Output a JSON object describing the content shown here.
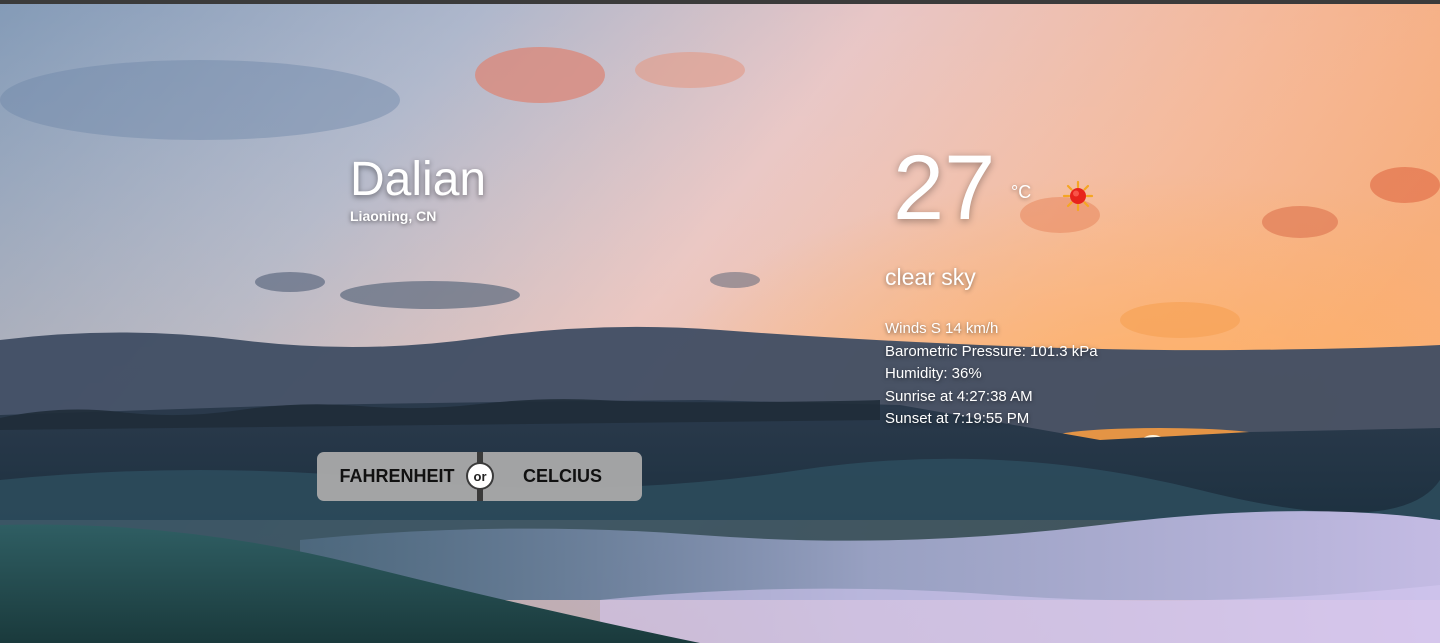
{
  "location": {
    "city": "Dalian",
    "region": "Liaoning, CN"
  },
  "weather": {
    "temperature": "27",
    "unit": "°C",
    "description": "clear sky",
    "icon": "sun-icon",
    "details": [
      "Winds S 14 km/h",
      "Barometric Pressure: 101.3 kPa",
      "Humidity: 36%",
      "Sunrise at 4:27:38 AM",
      "Sunset at 7:19:55 PM"
    ]
  },
  "toggle": {
    "fahrenheit_label": "FAHRENHEIT",
    "or_label": "or",
    "celcius_label": "CELCIUS"
  },
  "colors": {
    "sun": "#e8231c",
    "sun_rays": "#f5a623",
    "toggle_bg": "#aaaaaa",
    "divider": "#3a3a3a"
  }
}
